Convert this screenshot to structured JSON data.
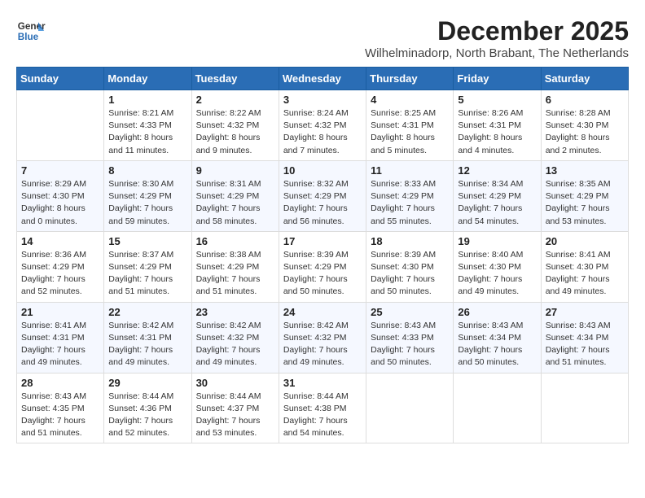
{
  "header": {
    "logo_line1": "General",
    "logo_line2": "Blue",
    "title": "December 2025",
    "subtitle": "Wilhelminadorp, North Brabant, The Netherlands"
  },
  "columns": [
    "Sunday",
    "Monday",
    "Tuesday",
    "Wednesday",
    "Thursday",
    "Friday",
    "Saturday"
  ],
  "weeks": [
    [
      {
        "day": "",
        "info": ""
      },
      {
        "day": "1",
        "info": "Sunrise: 8:21 AM\nSunset: 4:33 PM\nDaylight: 8 hours\nand 11 minutes."
      },
      {
        "day": "2",
        "info": "Sunrise: 8:22 AM\nSunset: 4:32 PM\nDaylight: 8 hours\nand 9 minutes."
      },
      {
        "day": "3",
        "info": "Sunrise: 8:24 AM\nSunset: 4:32 PM\nDaylight: 8 hours\nand 7 minutes."
      },
      {
        "day": "4",
        "info": "Sunrise: 8:25 AM\nSunset: 4:31 PM\nDaylight: 8 hours\nand 5 minutes."
      },
      {
        "day": "5",
        "info": "Sunrise: 8:26 AM\nSunset: 4:31 PM\nDaylight: 8 hours\nand 4 minutes."
      },
      {
        "day": "6",
        "info": "Sunrise: 8:28 AM\nSunset: 4:30 PM\nDaylight: 8 hours\nand 2 minutes."
      }
    ],
    [
      {
        "day": "7",
        "info": "Sunrise: 8:29 AM\nSunset: 4:30 PM\nDaylight: 8 hours\nand 0 minutes."
      },
      {
        "day": "8",
        "info": "Sunrise: 8:30 AM\nSunset: 4:29 PM\nDaylight: 7 hours\nand 59 minutes."
      },
      {
        "day": "9",
        "info": "Sunrise: 8:31 AM\nSunset: 4:29 PM\nDaylight: 7 hours\nand 58 minutes."
      },
      {
        "day": "10",
        "info": "Sunrise: 8:32 AM\nSunset: 4:29 PM\nDaylight: 7 hours\nand 56 minutes."
      },
      {
        "day": "11",
        "info": "Sunrise: 8:33 AM\nSunset: 4:29 PM\nDaylight: 7 hours\nand 55 minutes."
      },
      {
        "day": "12",
        "info": "Sunrise: 8:34 AM\nSunset: 4:29 PM\nDaylight: 7 hours\nand 54 minutes."
      },
      {
        "day": "13",
        "info": "Sunrise: 8:35 AM\nSunset: 4:29 PM\nDaylight: 7 hours\nand 53 minutes."
      }
    ],
    [
      {
        "day": "14",
        "info": "Sunrise: 8:36 AM\nSunset: 4:29 PM\nDaylight: 7 hours\nand 52 minutes."
      },
      {
        "day": "15",
        "info": "Sunrise: 8:37 AM\nSunset: 4:29 PM\nDaylight: 7 hours\nand 51 minutes."
      },
      {
        "day": "16",
        "info": "Sunrise: 8:38 AM\nSunset: 4:29 PM\nDaylight: 7 hours\nand 51 minutes."
      },
      {
        "day": "17",
        "info": "Sunrise: 8:39 AM\nSunset: 4:29 PM\nDaylight: 7 hours\nand 50 minutes."
      },
      {
        "day": "18",
        "info": "Sunrise: 8:39 AM\nSunset: 4:30 PM\nDaylight: 7 hours\nand 50 minutes."
      },
      {
        "day": "19",
        "info": "Sunrise: 8:40 AM\nSunset: 4:30 PM\nDaylight: 7 hours\nand 49 minutes."
      },
      {
        "day": "20",
        "info": "Sunrise: 8:41 AM\nSunset: 4:30 PM\nDaylight: 7 hours\nand 49 minutes."
      }
    ],
    [
      {
        "day": "21",
        "info": "Sunrise: 8:41 AM\nSunset: 4:31 PM\nDaylight: 7 hours\nand 49 minutes."
      },
      {
        "day": "22",
        "info": "Sunrise: 8:42 AM\nSunset: 4:31 PM\nDaylight: 7 hours\nand 49 minutes."
      },
      {
        "day": "23",
        "info": "Sunrise: 8:42 AM\nSunset: 4:32 PM\nDaylight: 7 hours\nand 49 minutes."
      },
      {
        "day": "24",
        "info": "Sunrise: 8:42 AM\nSunset: 4:32 PM\nDaylight: 7 hours\nand 49 minutes."
      },
      {
        "day": "25",
        "info": "Sunrise: 8:43 AM\nSunset: 4:33 PM\nDaylight: 7 hours\nand 50 minutes."
      },
      {
        "day": "26",
        "info": "Sunrise: 8:43 AM\nSunset: 4:34 PM\nDaylight: 7 hours\nand 50 minutes."
      },
      {
        "day": "27",
        "info": "Sunrise: 8:43 AM\nSunset: 4:34 PM\nDaylight: 7 hours\nand 51 minutes."
      }
    ],
    [
      {
        "day": "28",
        "info": "Sunrise: 8:43 AM\nSunset: 4:35 PM\nDaylight: 7 hours\nand 51 minutes."
      },
      {
        "day": "29",
        "info": "Sunrise: 8:44 AM\nSunset: 4:36 PM\nDaylight: 7 hours\nand 52 minutes."
      },
      {
        "day": "30",
        "info": "Sunrise: 8:44 AM\nSunset: 4:37 PM\nDaylight: 7 hours\nand 53 minutes."
      },
      {
        "day": "31",
        "info": "Sunrise: 8:44 AM\nSunset: 4:38 PM\nDaylight: 7 hours\nand 54 minutes."
      },
      {
        "day": "",
        "info": ""
      },
      {
        "day": "",
        "info": ""
      },
      {
        "day": "",
        "info": ""
      }
    ]
  ]
}
